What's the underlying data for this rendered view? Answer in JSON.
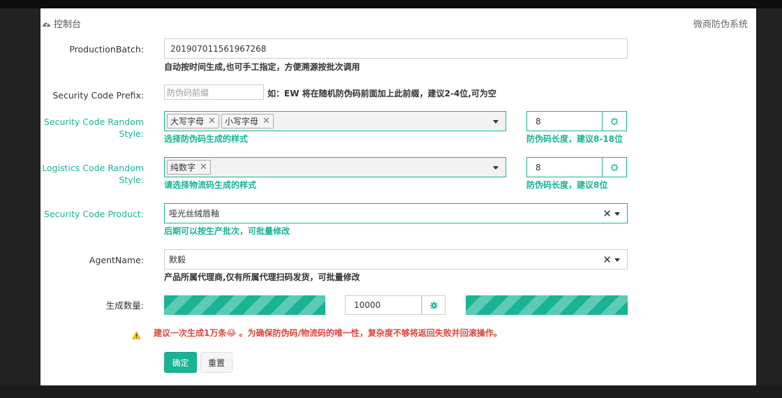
{
  "header": {
    "breadcrumb": "控制台",
    "breadcrumb_icon": "dashboard-icon",
    "system_title": "微商防伪系统"
  },
  "form": {
    "production_batch": {
      "label": "ProductionBatch:",
      "value": "201907011561967268",
      "help": "自动按时间生成,也可手工指定，方便溯源按批次调用"
    },
    "security_prefix": {
      "label": "Security Code Prefix:",
      "placeholder": "防伪码前缀",
      "help": "如：EW 将在随机防伪码前面加上此前缀，建议2-4位,可为空"
    },
    "security_random_style": {
      "label_line1": "Security Code Random",
      "label_line2": "Style:",
      "tags": [
        "大写字母",
        "小写字母"
      ],
      "help": "选择防伪码生成的样式",
      "length_value": "8",
      "length_help": "防伪码长度，建议8-18位"
    },
    "logistics_random_style": {
      "label_line1": "Logistics Code Random",
      "label_line2": "Style:",
      "tags": [
        "纯数字"
      ],
      "help": "请选择物流码生成的样式",
      "length_value": "8",
      "length_help": "防伪码长度，建议8位"
    },
    "security_product": {
      "label": "Security Code Product:",
      "value": "哑光丝绒唇釉",
      "help": "后期可以按生产批次，可批量修改"
    },
    "agent_name": {
      "label": "AgentName:",
      "value": "默毅",
      "help": "产品所属代理商,仅有所属代理扫码发货，可批量修改"
    },
    "quantity": {
      "label": "生成数量:",
      "value": "10000"
    },
    "warning": "建议一次生成1万条😂 。为确保防伪码/物流码的唯一性，复杂度不够将返回失败并回滚操作。",
    "submit_label": "确定",
    "reset_label": "重置"
  },
  "colors": {
    "accent": "#1ab394",
    "warning_text": "#e0453c"
  }
}
